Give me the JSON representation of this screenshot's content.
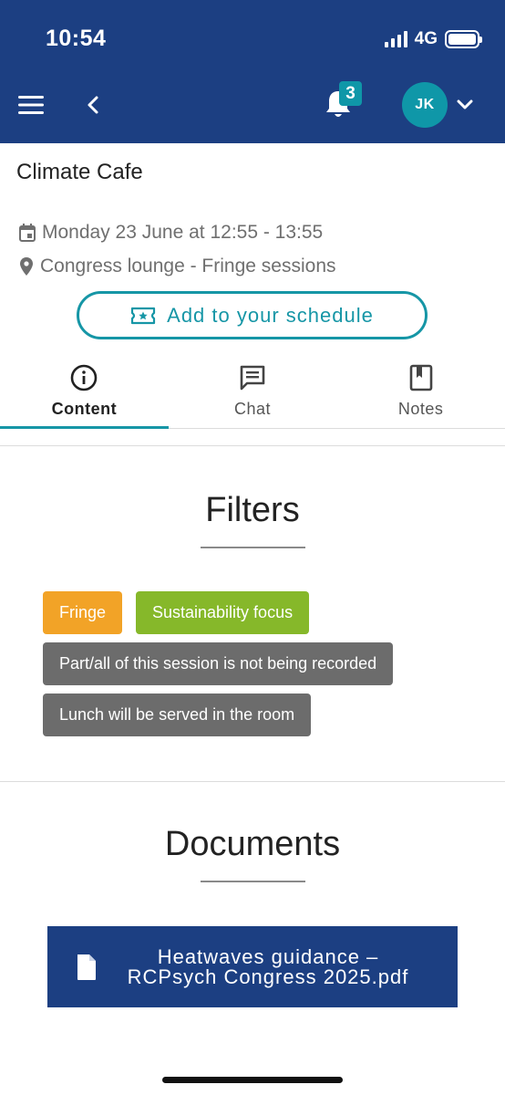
{
  "status_bar": {
    "time": "10:54",
    "network": "4G"
  },
  "header": {
    "notification_count": "3",
    "user_initials": "JK"
  },
  "session": {
    "title": "Climate Cafe",
    "date_time": "Monday 23 June at 12:55 - 13:55",
    "location": "Congress lounge - Fringe sessions",
    "schedule_button_label": "Add to your schedule"
  },
  "tabs": [
    {
      "label": "Content",
      "icon": "info-icon",
      "active": true
    },
    {
      "label": "Chat",
      "icon": "chat-icon",
      "active": false
    },
    {
      "label": "Notes",
      "icon": "bookmark-icon",
      "active": false
    }
  ],
  "filters": {
    "heading": "Filters",
    "tags": [
      {
        "label": "Fringe",
        "color": "#f2a327"
      },
      {
        "label": "Sustainability focus",
        "color": "#86b82a"
      },
      {
        "label": "Part/all of this session is not being recorded",
        "color": "#6c6c6c"
      },
      {
        "label": "Lunch will be served in the room",
        "color": "#6c6c6c"
      }
    ]
  },
  "documents": {
    "heading": "Documents",
    "items": [
      {
        "line1": "Heatwaves guidance –",
        "line2": "RCPsych Congress 2025.pdf",
        "icon": "file-icon"
      }
    ]
  },
  "colors": {
    "brand_navy": "#1c3f82",
    "accent_teal": "#1696a6"
  }
}
